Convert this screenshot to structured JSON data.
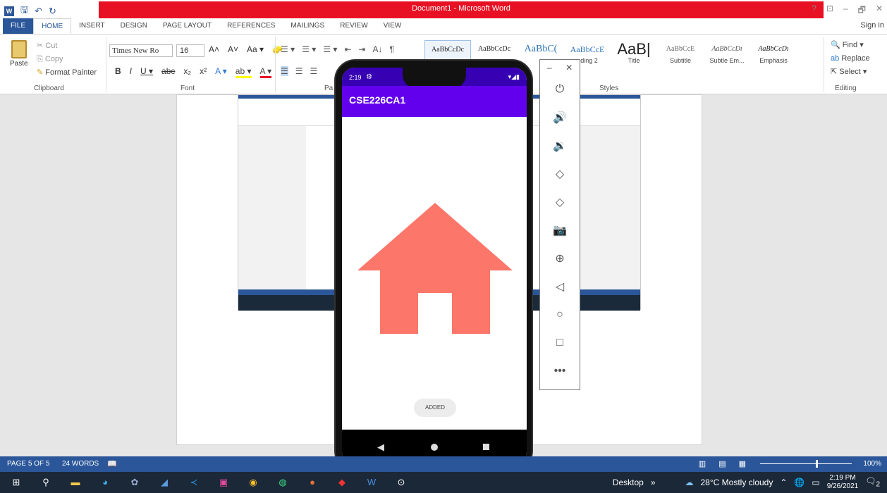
{
  "window": {
    "title": "Document1 - Microsoft Word",
    "controls": [
      "?",
      "⊡",
      "–",
      "🗗",
      "✕"
    ]
  },
  "tabs": [
    "FILE",
    "HOME",
    "INSERT",
    "DESIGN",
    "PAGE LAYOUT",
    "REFERENCES",
    "MAILINGS",
    "REVIEW",
    "VIEW"
  ],
  "sign_in": "Sign in",
  "clipboard": {
    "paste": "Paste",
    "cut": "Cut",
    "copy": "Copy",
    "format_painter": "Format Painter",
    "label": "Clipboard"
  },
  "font": {
    "name": "Times New Ro",
    "size": "16",
    "label": "Font",
    "row1": [
      "A˄",
      "A˅",
      "Aa ▾",
      "🧽"
    ],
    "row2": [
      "B",
      "I",
      "U ▾",
      "abc",
      "x₂",
      "x²",
      "A ▾",
      "ab ▾",
      "A ▾"
    ]
  },
  "paragraph": {
    "label": "Pa",
    "row1": [
      "☰ ▾",
      "☰ ▾",
      "☰ ▾",
      "⇤",
      "⇥",
      "A↓",
      "¶"
    ]
  },
  "styles": {
    "label": "Styles",
    "items": [
      {
        "preview": "AaBbCcDc",
        "name": ""
      },
      {
        "preview": "AaBbCcDc",
        "name": ""
      },
      {
        "preview": "AaBbC(",
        "name": ""
      },
      {
        "preview": "AaBbCcE",
        "name": "ading 2"
      },
      {
        "preview": "AaB|",
        "name": "Title"
      },
      {
        "preview": "AaBbCcE",
        "name": "Subtitle"
      },
      {
        "preview": "AaBbCcDı",
        "name": "Subtle Em..."
      },
      {
        "preview": "AaBbCcDı",
        "name": "Emphasis"
      }
    ]
  },
  "editing": {
    "find": "Find",
    "replace": "Replace",
    "select": "Select",
    "label": "Editing"
  },
  "phone": {
    "time": "2:19",
    "app_title": "CSE226CA1",
    "toast": "ADDED",
    "house_color": "#fc7669"
  },
  "status": {
    "page": "PAGE 5 OF 5",
    "words": "24 WORDS",
    "zoom": "100%"
  },
  "taskbar": {
    "desktop": "Desktop",
    "chevron": "»",
    "weather": "28°C Mostly cloudy",
    "time": "2:19 PM",
    "date": "9/26/2021",
    "notifications": "2"
  }
}
